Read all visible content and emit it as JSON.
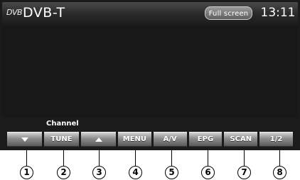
{
  "header": {
    "source_logo": "DVB",
    "source_title": "DVB-T",
    "fullscreen_label": "Full screen",
    "clock": "13:11"
  },
  "bottom": {
    "channel_label": "Channel",
    "left_buttons": [
      {
        "label": "",
        "icon": "down-triangle-icon"
      },
      {
        "label": "TUNE"
      },
      {
        "label": "",
        "icon": "up-triangle-icon"
      }
    ],
    "right_buttons": [
      {
        "label": "MENU"
      },
      {
        "label": "A/V"
      },
      {
        "label": "EPG"
      },
      {
        "label": "SCAN"
      },
      {
        "label": "1/2"
      }
    ]
  },
  "callouts": [
    "1",
    "2",
    "3",
    "4",
    "5",
    "6",
    "7",
    "8"
  ],
  "colors": {
    "screen_bg": "#1b1b1b",
    "button_gradient_top": "#d2d2d2",
    "button_gradient_bottom": "#5b5b5b",
    "text": "#ffffff"
  }
}
